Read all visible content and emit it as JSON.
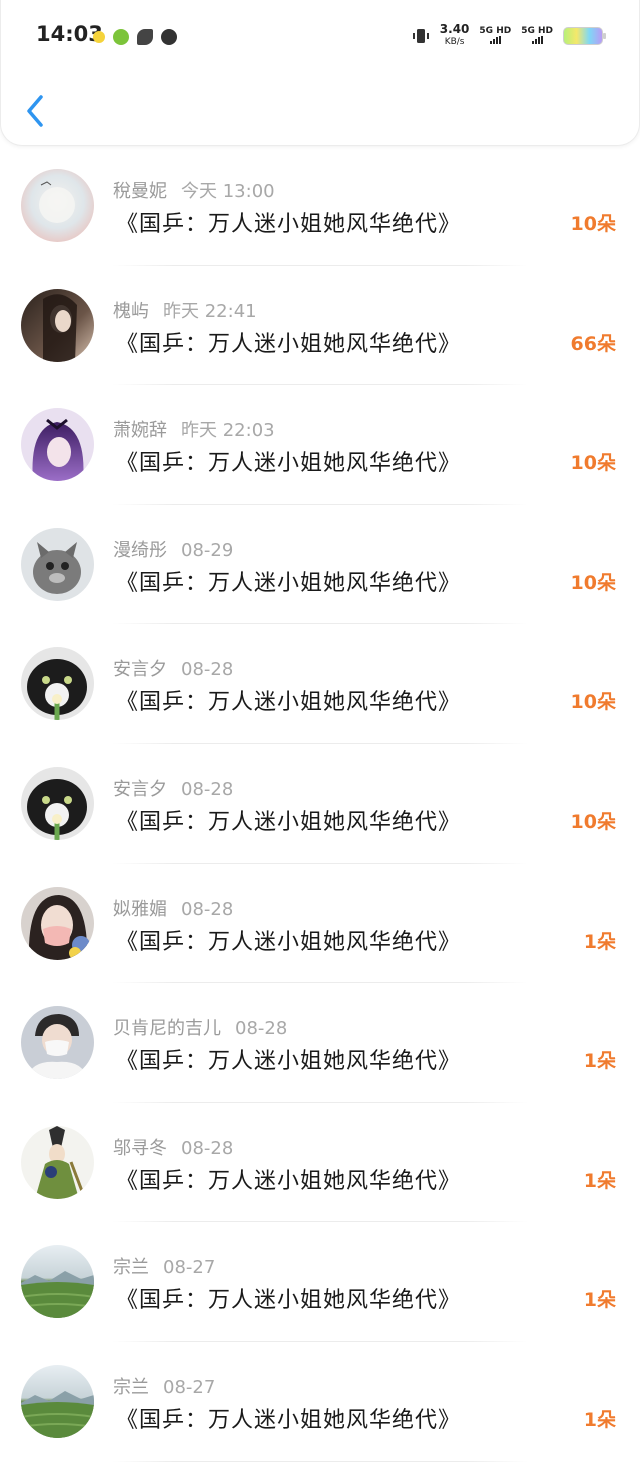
{
  "status_bar": {
    "time": "14:03",
    "speed_value": "3.40",
    "speed_unit": "KB/s",
    "net1": "5G HD",
    "net2": "5G HD"
  },
  "rows": [
    {
      "name": "稅曼妮",
      "date": "今天 13:00",
      "title": "《国乒：万人迷小姐她风华绝代》",
      "count": "10朵",
      "avatar": "avatar-mist"
    },
    {
      "name": "槐屿",
      "date": "昨天 22:41",
      "title": "《国乒：万人迷小姐她风华绝代》",
      "count": "66朵",
      "avatar": "avatar-girl-dark"
    },
    {
      "name": "萧婉辞",
      "date": "昨天 22:03",
      "title": "《国乒：万人迷小姐她风华绝代》",
      "count": "10朵",
      "avatar": "avatar-anime-purple"
    },
    {
      "name": "漫绮彤",
      "date": "08-29",
      "title": "《国乒：万人迷小姐她风华绝代》",
      "count": "10朵",
      "avatar": "avatar-kitten"
    },
    {
      "name": "安言夕",
      "date": "08-28",
      "title": "《国乒：万人迷小姐她风华绝代》",
      "count": "10朵",
      "avatar": "avatar-cat-flower"
    },
    {
      "name": "安言夕",
      "date": "08-28",
      "title": "《国乒：万人迷小姐她风华绝代》",
      "count": "10朵",
      "avatar": "avatar-cat-flower"
    },
    {
      "name": "姒雅媚",
      "date": "08-28",
      "title": "《国乒：万人迷小姐她风华绝代》",
      "count": "1朵",
      "avatar": "avatar-girl-mask"
    },
    {
      "name": "贝肯尼的吉儿",
      "date": "08-28",
      "title": "《国乒：万人迷小姐她风华绝代》",
      "count": "1朵",
      "avatar": "avatar-boy-mask"
    },
    {
      "name": "邬寻冬",
      "date": "08-28",
      "title": "《国乒：万人迷小姐她风华绝代》",
      "count": "1朵",
      "avatar": "avatar-anime-warrior"
    },
    {
      "name": "宗兰",
      "date": "08-27",
      "title": "《国乒：万人迷小姐她风华绝代》",
      "count": "1朵",
      "avatar": "avatar-landscape"
    },
    {
      "name": "宗兰",
      "date": "08-27",
      "title": "《国乒：万人迷小姐她风华绝代》",
      "count": "1朵",
      "avatar": "avatar-landscape"
    }
  ]
}
